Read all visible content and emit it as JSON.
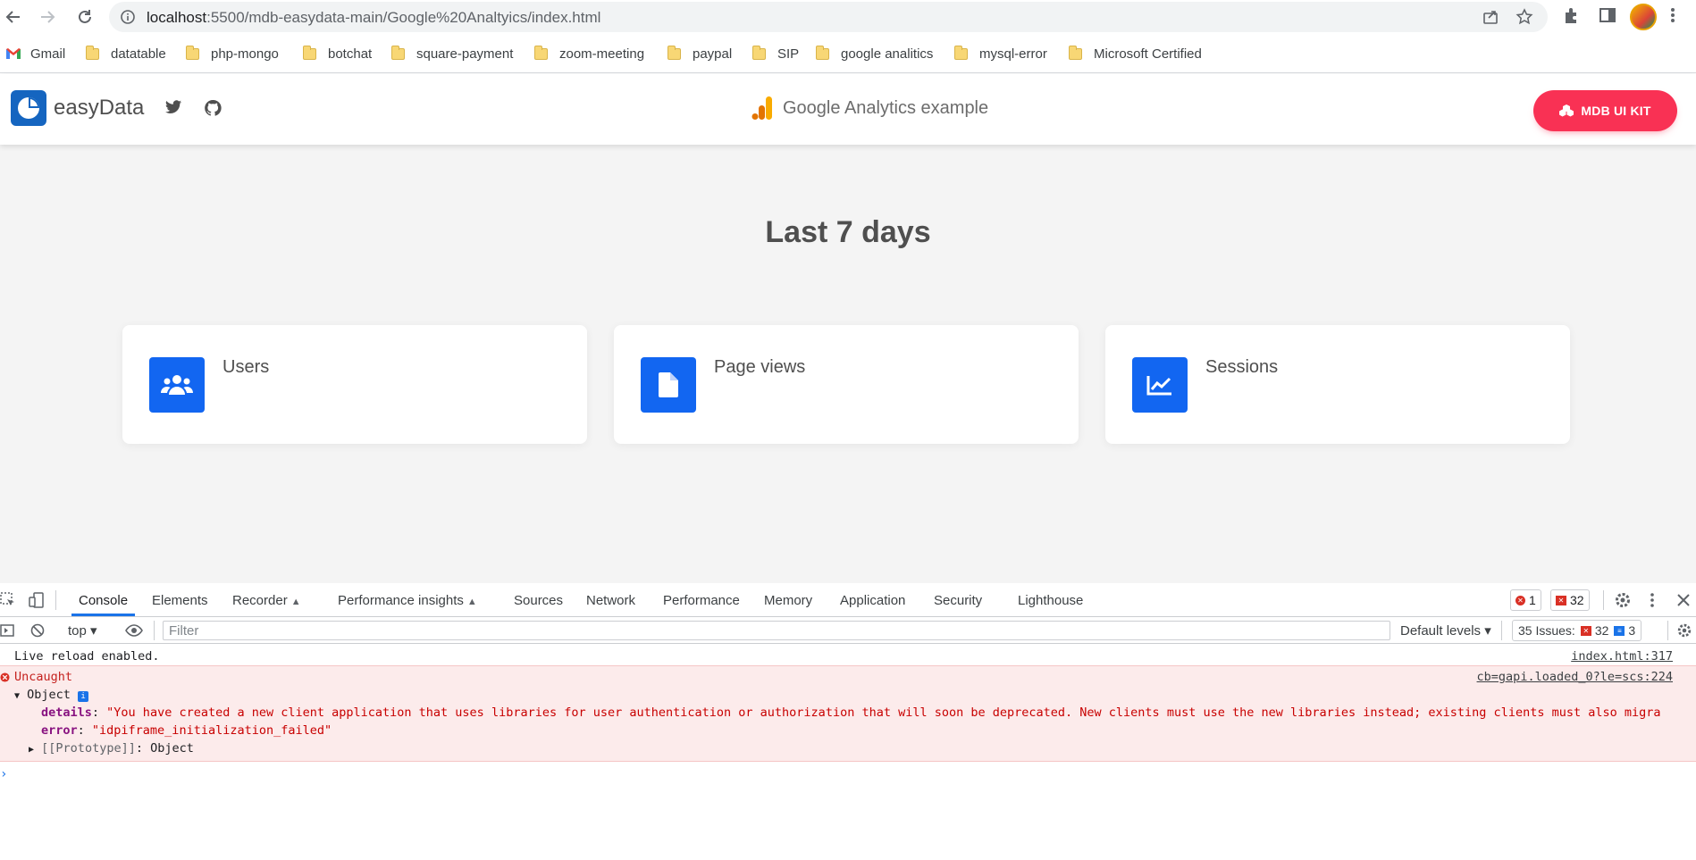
{
  "browser": {
    "url_host": "localhost",
    "url_path": ":5500/mdb-easydata-main/Google%20Analtyics/index.html",
    "bookmarks": [
      {
        "label": "Gmail",
        "type": "gmail"
      },
      {
        "label": "datatable",
        "type": "folder"
      },
      {
        "label": "php-mongo",
        "type": "folder"
      },
      {
        "label": "botchat",
        "type": "folder"
      },
      {
        "label": "square-payment",
        "type": "folder"
      },
      {
        "label": "zoom-meeting",
        "type": "folder"
      },
      {
        "label": "paypal",
        "type": "folder"
      },
      {
        "label": "SIP",
        "type": "folder"
      },
      {
        "label": "google analitics",
        "type": "folder"
      },
      {
        "label": "mysql-error",
        "type": "folder"
      },
      {
        "label": "Microsoft Certified",
        "type": "folder"
      }
    ]
  },
  "navbar": {
    "brand": "easyData",
    "center_title": "Google Analytics example",
    "cta_label": "MDB UI KIT"
  },
  "main": {
    "heading": "Last 7 days",
    "cards": [
      {
        "label": "Users",
        "icon": "users-icon"
      },
      {
        "label": "Page views",
        "icon": "file-icon"
      },
      {
        "label": "Sessions",
        "icon": "chart-line-icon"
      }
    ]
  },
  "devtools": {
    "tabs": [
      "Console",
      "Elements",
      "Recorder",
      "Performance insights",
      "Sources",
      "Network",
      "Performance",
      "Memory",
      "Application",
      "Security",
      "Lighthouse"
    ],
    "error_count": "1",
    "warning_count": "32",
    "context": "top",
    "filter_placeholder": "Filter",
    "levels": "Default levels",
    "issues_label": "35 Issues:",
    "issues_errors": "32",
    "issues_info": "3",
    "log": {
      "text": "Live reload enabled.",
      "source": "index.html:317"
    },
    "error": {
      "title": "Uncaught",
      "source": "cb=gapi.loaded_0?le=scs:224",
      "object_label": "Object",
      "details_key": "details",
      "details_value": "\"You have created a new client application that uses libraries for user authentication or authorization that will soon be deprecated. New clients must use the new libraries instead; existing clients must also migra",
      "error_key": "error",
      "error_value": "\"idpiframe_initialization_failed\"",
      "proto_key": "[[Prototype]]",
      "proto_value": "Object"
    }
  },
  "colors": {
    "mdb_red": "#f93154",
    "primary_blue": "#1266f1",
    "logo_blue": "#1565c0",
    "devtools_accent": "#1a73e8"
  }
}
